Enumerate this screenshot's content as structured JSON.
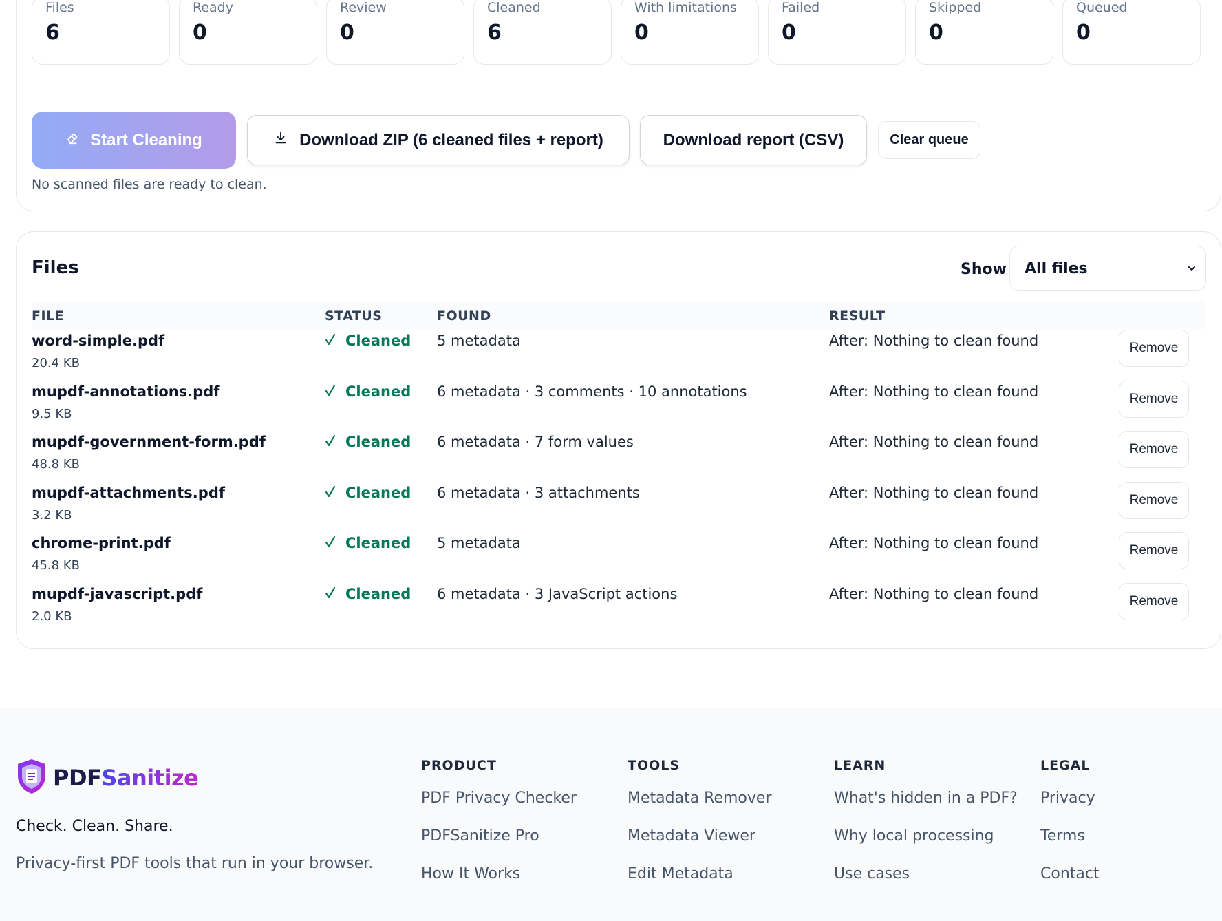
{
  "stats": [
    {
      "label": "Files",
      "value": "6"
    },
    {
      "label": "Ready",
      "value": "0"
    },
    {
      "label": "Review",
      "value": "0"
    },
    {
      "label": "Cleaned",
      "value": "6"
    },
    {
      "label": "With limitations",
      "value": "0"
    },
    {
      "label": "Failed",
      "value": "0"
    },
    {
      "label": "Skipped",
      "value": "0"
    },
    {
      "label": "Queued",
      "value": "0"
    }
  ],
  "actions": {
    "start_label": "Start Cleaning",
    "zip_label": "Download ZIP (6 cleaned files + report)",
    "csv_label": "Download report (CSV)",
    "clear_label": "Clear queue",
    "hint": "No scanned files are ready to clean."
  },
  "files": {
    "title": "Files",
    "show_label": "Show",
    "filter_value": "All files",
    "columns": {
      "file": "FILE",
      "status": "STATUS",
      "found": "FOUND",
      "result": "RESULT"
    },
    "rows": [
      {
        "name": "word-simple.pdf",
        "size": "20.4 KB",
        "status": "Cleaned",
        "found": "5 metadata",
        "result": "After: Nothing to clean found",
        "action": "Remove"
      },
      {
        "name": "mupdf-annotations.pdf",
        "size": "9.5 KB",
        "status": "Cleaned",
        "found": "6 metadata · 3 comments · 10 annotations",
        "result": "After: Nothing to clean found",
        "action": "Remove"
      },
      {
        "name": "mupdf-government-form.pdf",
        "size": "48.8 KB",
        "status": "Cleaned",
        "found": "6 metadata · 7 form values",
        "result": "After: Nothing to clean found",
        "action": "Remove"
      },
      {
        "name": "mupdf-attachments.pdf",
        "size": "3.2 KB",
        "status": "Cleaned",
        "found": "6 metadata · 3 attachments",
        "result": "After: Nothing to clean found",
        "action": "Remove"
      },
      {
        "name": "chrome-print.pdf",
        "size": "45.8 KB",
        "status": "Cleaned",
        "found": "5 metadata",
        "result": "After: Nothing to clean found",
        "action": "Remove"
      },
      {
        "name": "mupdf-javascript.pdf",
        "size": "2.0 KB",
        "status": "Cleaned",
        "found": "6 metadata · 3 JavaScript actions",
        "result": "After: Nothing to clean found",
        "action": "Remove"
      }
    ]
  },
  "footer": {
    "brand_a": "PDF",
    "brand_b": "Sanitize",
    "tagline": "Check. Clean. Share.",
    "description": "Privacy-first PDF tools that run in your browser.",
    "columns": [
      {
        "heading": "PRODUCT",
        "links": [
          "PDF Privacy Checker",
          "PDFSanitize Pro",
          "How It Works"
        ]
      },
      {
        "heading": "TOOLS",
        "links": [
          "Metadata Remover",
          "Metadata Viewer",
          "Edit Metadata"
        ]
      },
      {
        "heading": "LEARN",
        "links": [
          "What's hidden in a PDF?",
          "Why local processing",
          "Use cases"
        ]
      },
      {
        "heading": "LEGAL",
        "links": [
          "Privacy",
          "Terms",
          "Contact"
        ]
      }
    ]
  },
  "colors": {
    "cleaned_green": "#047857",
    "start_gradient_from": "#93abf6",
    "start_gradient_to": "#b39be8",
    "brand_indigo": "#4f46e5",
    "brand_magenta": "#c026d3"
  },
  "icons": {
    "start": "eraser-icon",
    "zip": "download-icon",
    "status": "check-icon",
    "select": "chevron-down-icon",
    "logo": "shield-document-icon"
  }
}
